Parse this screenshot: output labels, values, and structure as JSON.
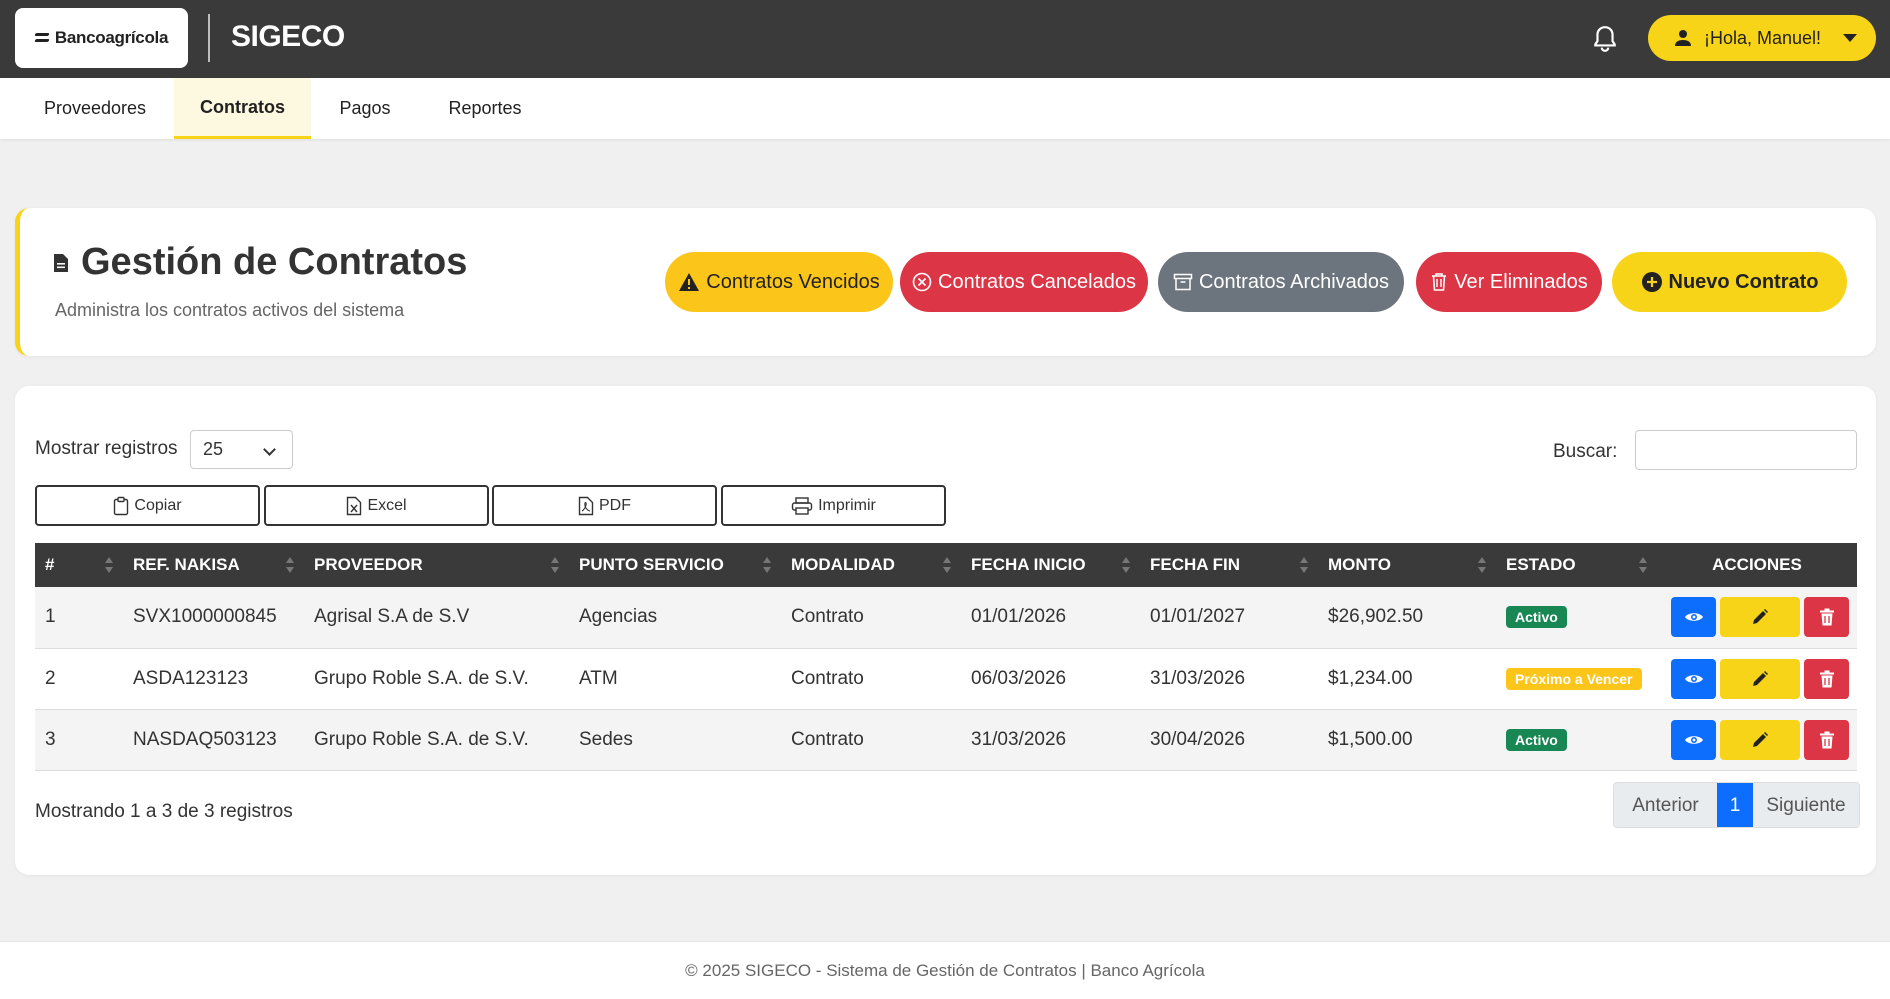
{
  "brand": {
    "logo_text": "Bancoagrícola",
    "app_title": "SIGECO"
  },
  "user": {
    "greeting": "¡Hola, Manuel!"
  },
  "nav": {
    "tabs": [
      {
        "label": "Proveedores",
        "active": false
      },
      {
        "label": "Contratos",
        "active": true
      },
      {
        "label": "Pagos",
        "active": false
      },
      {
        "label": "Reportes",
        "active": false
      }
    ]
  },
  "header": {
    "title": "Gestión de Contratos",
    "subtitle": "Administra los contratos activos del sistema",
    "buttons": [
      {
        "label": "Contratos Vencidos",
        "icon": "warning-icon",
        "bg": "#fbc51a",
        "fg": "#222"
      },
      {
        "label": "Contratos Cancelados",
        "icon": "x-circle-icon",
        "bg": "#dc3545",
        "fg": "#fff"
      },
      {
        "label": "Contratos Archivados",
        "icon": "archive-icon",
        "bg": "#6c757d",
        "fg": "#fff"
      },
      {
        "label": "Ver Eliminados",
        "icon": "trash-icon",
        "bg": "#dc3545",
        "fg": "#fff"
      },
      {
        "label": "Nuevo Contrato",
        "icon": "plus-circle-icon",
        "bg": "#f7d418",
        "fg": "#222"
      }
    ]
  },
  "controls": {
    "length_label": "Mostrar registros",
    "length_value": "25",
    "search_label": "Buscar:",
    "search_value": "",
    "export_buttons": [
      {
        "label": "Copiar",
        "icon": "clipboard-icon"
      },
      {
        "label": "Excel",
        "icon": "excel-file-icon"
      },
      {
        "label": "PDF",
        "icon": "pdf-file-icon"
      },
      {
        "label": "Imprimir",
        "icon": "printer-icon"
      }
    ]
  },
  "table": {
    "columns": [
      "#",
      "REF. NAKISA",
      "PROVEEDOR",
      "PUNTO SERVICIO",
      "MODALIDAD",
      "FECHA INICIO",
      "FECHA FIN",
      "MONTO",
      "ESTADO",
      "ACCIONES"
    ],
    "rows": [
      {
        "num": "1",
        "ref": "SVX1000000845",
        "proveedor": "Agrisal S.A de S.V",
        "punto": "Agencias",
        "modalidad": "Contrato",
        "inicio": "01/01/2026",
        "fin": "01/01/2027",
        "monto": "$26,902.50",
        "estado": "Activo",
        "estado_color": "#198754"
      },
      {
        "num": "2",
        "ref": "ASDA123123",
        "proveedor": "Grupo Roble S.A. de S.V.",
        "punto": "ATM",
        "modalidad": "Contrato",
        "inicio": "06/03/2026",
        "fin": "31/03/2026",
        "monto": "$1,234.00",
        "estado": "Próximo a Vencer",
        "estado_color": "#fbc51a"
      },
      {
        "num": "3",
        "ref": "NASDAQ503123",
        "proveedor": "Grupo Roble S.A. de S.V.",
        "punto": "Sedes",
        "modalidad": "Contrato",
        "inicio": "31/03/2026",
        "fin": "30/04/2026",
        "monto": "$1,500.00",
        "estado": "Activo",
        "estado_color": "#198754"
      }
    ]
  },
  "pagination": {
    "info": "Mostrando 1 a 3 de 3 registros",
    "prev": "Anterior",
    "current": "1",
    "next": "Siguiente"
  },
  "footer": {
    "text": "© 2025 SIGECO - Sistema de Gestión de Contratos | Banco Agrícola"
  },
  "colors": {
    "brand_yellow": "#f7d418",
    "dark": "#3a3a3a",
    "primary_blue": "#0d6efd",
    "danger_red": "#dc3545"
  }
}
